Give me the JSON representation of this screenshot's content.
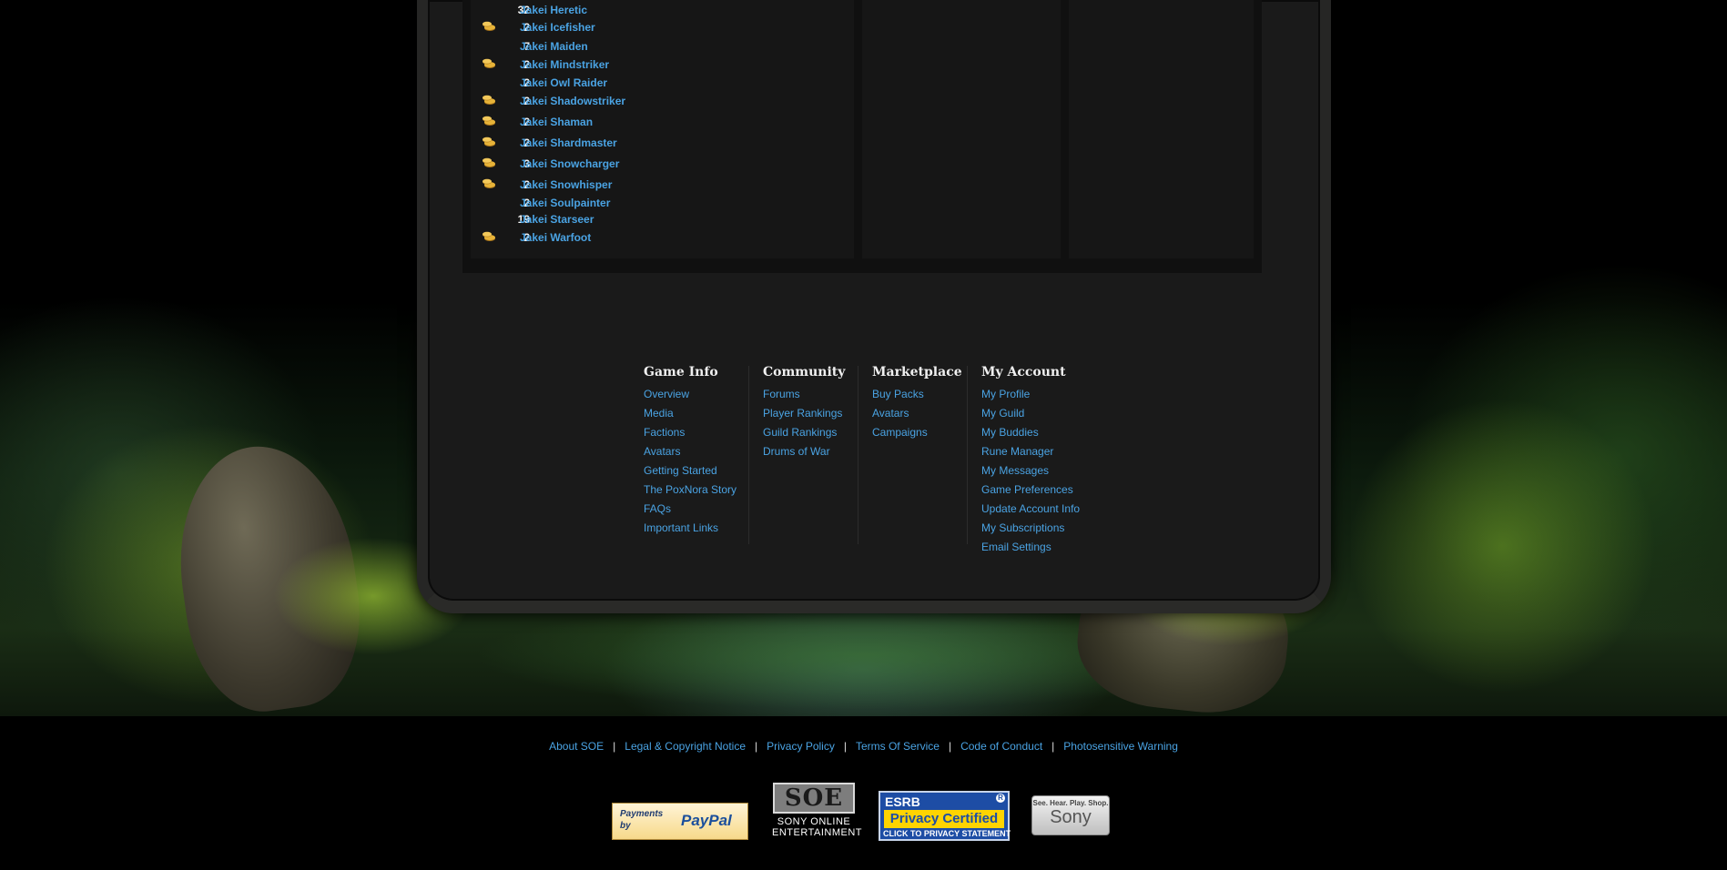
{
  "characters": [
    {
      "count": "32",
      "name": "Jakei Heretic",
      "coin": false
    },
    {
      "count": "2",
      "name": "Jakei Icefisher",
      "coin": true
    },
    {
      "count": "7",
      "name": "Jakei Maiden",
      "coin": false
    },
    {
      "count": "2",
      "name": "Jakei Mindstriker",
      "coin": true
    },
    {
      "count": "2",
      "name": "Jakei Owl Raider",
      "coin": false
    },
    {
      "count": "2",
      "name": "Jakei Shadowstriker",
      "coin": true
    },
    {
      "count": "2",
      "name": "Jakei Shaman",
      "coin": true
    },
    {
      "count": "2",
      "name": "Jakei Shardmaster",
      "coin": true
    },
    {
      "count": "3",
      "name": "Jakei Snowcharger",
      "coin": true
    },
    {
      "count": "2",
      "name": "Jakei Snowhisper",
      "coin": true
    },
    {
      "count": "2",
      "name": "Jakei Soulpainter",
      "coin": false
    },
    {
      "count": "19",
      "name": "Jakei Starseer",
      "coin": false
    },
    {
      "count": "2",
      "name": "Jakei Warfoot",
      "coin": true
    }
  ],
  "footer_nav": {
    "game_info": {
      "heading": "Game Info",
      "links": [
        "Overview",
        "Media",
        "Factions",
        "Avatars",
        "Getting Started",
        "The PoxNora Story",
        "FAQs",
        "Important Links"
      ]
    },
    "community": {
      "heading": "Community",
      "links": [
        "Forums",
        "Player Rankings",
        "Guild Rankings",
        "Drums of War"
      ]
    },
    "marketplace": {
      "heading": "Marketplace",
      "links": [
        "Buy Packs",
        "Avatars",
        "Campaigns"
      ]
    },
    "my_account": {
      "heading": "My Account",
      "links": [
        "My Profile",
        "My Guild",
        "My Buddies",
        "Rune Manager",
        "My Messages",
        "Game Preferences",
        "Update Account Info",
        "My Subscriptions",
        "Email Settings"
      ]
    }
  },
  "legal_links": [
    "About SOE",
    "Legal & Copyright Notice",
    "Privacy Policy",
    "Terms Of Service",
    "Code of Conduct",
    "Photosensitive Warning"
  ],
  "legal_separator": "|",
  "badges": {
    "paypal": {
      "prefix": "Payments by",
      "brand": "PayPal"
    },
    "soe": {
      "logo": "SOE",
      "line1": "SONY ONLINE",
      "line2": "ENTERTAINMENT"
    },
    "esrb": {
      "brand": "ESRB",
      "mark": "R",
      "label": "Privacy Certified",
      "sub": "CLICK TO PRIVACY STATEMENT"
    },
    "sony": {
      "tagline": "See. Hear. Play. Shop.",
      "brand": "Sony"
    }
  },
  "colors": {
    "link": "#4aa3e3",
    "coin": "#e0a32a",
    "panel": "#1a1a1a"
  },
  "icons": {
    "coin": "gold-coins-icon"
  }
}
